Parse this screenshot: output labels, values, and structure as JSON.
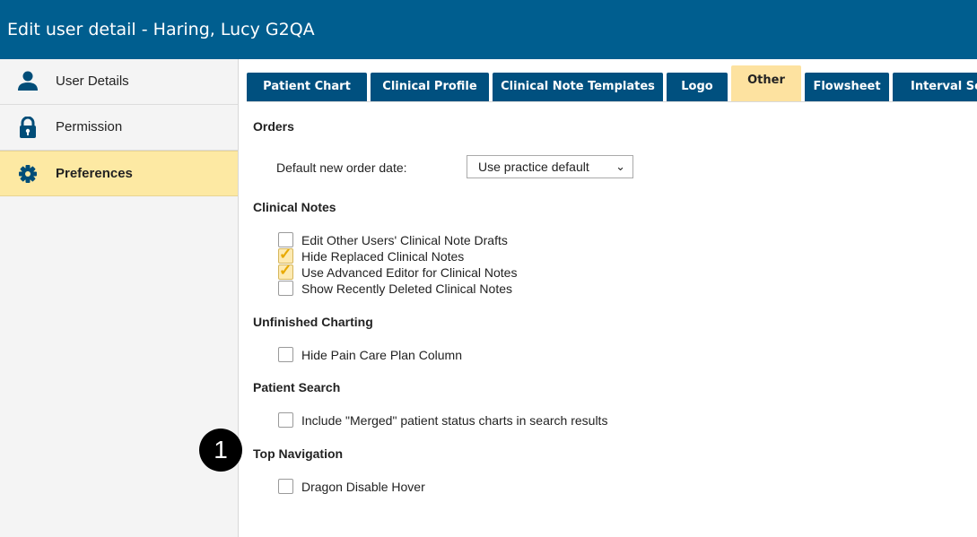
{
  "window": {
    "title": "Edit user detail - Haring, Lucy G2QA"
  },
  "sidebar": {
    "items": [
      {
        "label": "User Details",
        "icon": "user-icon"
      },
      {
        "label": "Permission",
        "icon": "lock-icon"
      },
      {
        "label": "Preferences",
        "icon": "gear-icon",
        "active": true
      }
    ]
  },
  "tabs": [
    {
      "label": "Patient Chart"
    },
    {
      "label": "Clinical Profile"
    },
    {
      "label": "Clinical Note Templates"
    },
    {
      "label": "Logo"
    },
    {
      "label": "Other",
      "active": true
    },
    {
      "label": "Flowsheet"
    },
    {
      "label": "Interval Se"
    }
  ],
  "orders": {
    "title": "Orders",
    "default_date_label": "Default new order date:",
    "default_date_value": "Use practice default"
  },
  "clinical_notes": {
    "title": "Clinical Notes",
    "options": [
      {
        "label": "Edit Other Users' Clinical Note Drafts",
        "checked": false
      },
      {
        "label": "Hide Replaced Clinical Notes",
        "checked": true
      },
      {
        "label": "Use Advanced Editor for Clinical Notes",
        "checked": true
      },
      {
        "label": "Show Recently Deleted Clinical Notes",
        "checked": false
      }
    ]
  },
  "unfinished_charting": {
    "title": "Unfinished Charting",
    "options": [
      {
        "label": "Hide Pain Care Plan Column",
        "checked": false
      }
    ]
  },
  "patient_search": {
    "title": "Patient Search",
    "options": [
      {
        "label": "Include \"Merged\" patient status charts in search results",
        "checked": false
      }
    ]
  },
  "top_navigation": {
    "title": "Top Navigation",
    "options": [
      {
        "label": "Dragon Disable Hover",
        "checked": false
      }
    ]
  },
  "callout": {
    "number": "1"
  },
  "colors": {
    "titlebar": "#005e8f",
    "tab": "#00507f",
    "active_tab": "#fde2a0",
    "active_sidebar": "#fde9a3",
    "check_mark": "#e8a900"
  }
}
